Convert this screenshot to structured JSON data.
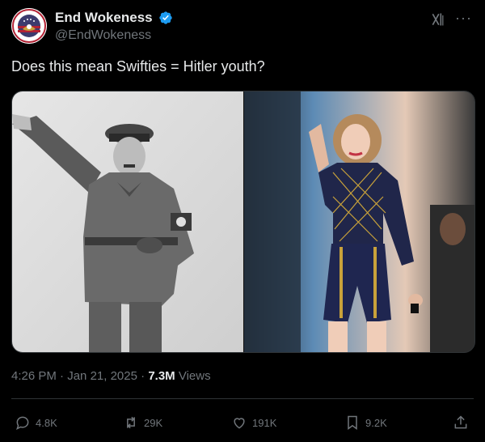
{
  "author": {
    "display_name": "End Wokeness",
    "handle": "@EndWokeness",
    "avatar_icon": "avatar-eagle-flag-icon",
    "avatar_ring_text_top": "SUPPORT",
    "avatar_ring_text_bottom": "WOMEN'S SPORTS",
    "verified_color": "#1d9bf0"
  },
  "header": {
    "more_label": "···"
  },
  "tweet": {
    "text": "Does this mean Swifties = Hitler youth?"
  },
  "media": {
    "left_image": "black-and-white-photo-man-in-uniform-saluting",
    "right_image": "color-photo-performer-raising-hand-on-stage"
  },
  "meta": {
    "time": "4:26 PM",
    "separator": " · ",
    "date": "Jan 21, 2025",
    "views_count": "7.3M",
    "views_label": "Views"
  },
  "actions": {
    "replies": "4.8K",
    "reposts": "29K",
    "likes": "191K",
    "bookmarks": "9.2K"
  },
  "colors": {
    "background": "#000000",
    "text": "#e7e9ea",
    "muted": "#71767b",
    "border": "#2f3336"
  }
}
